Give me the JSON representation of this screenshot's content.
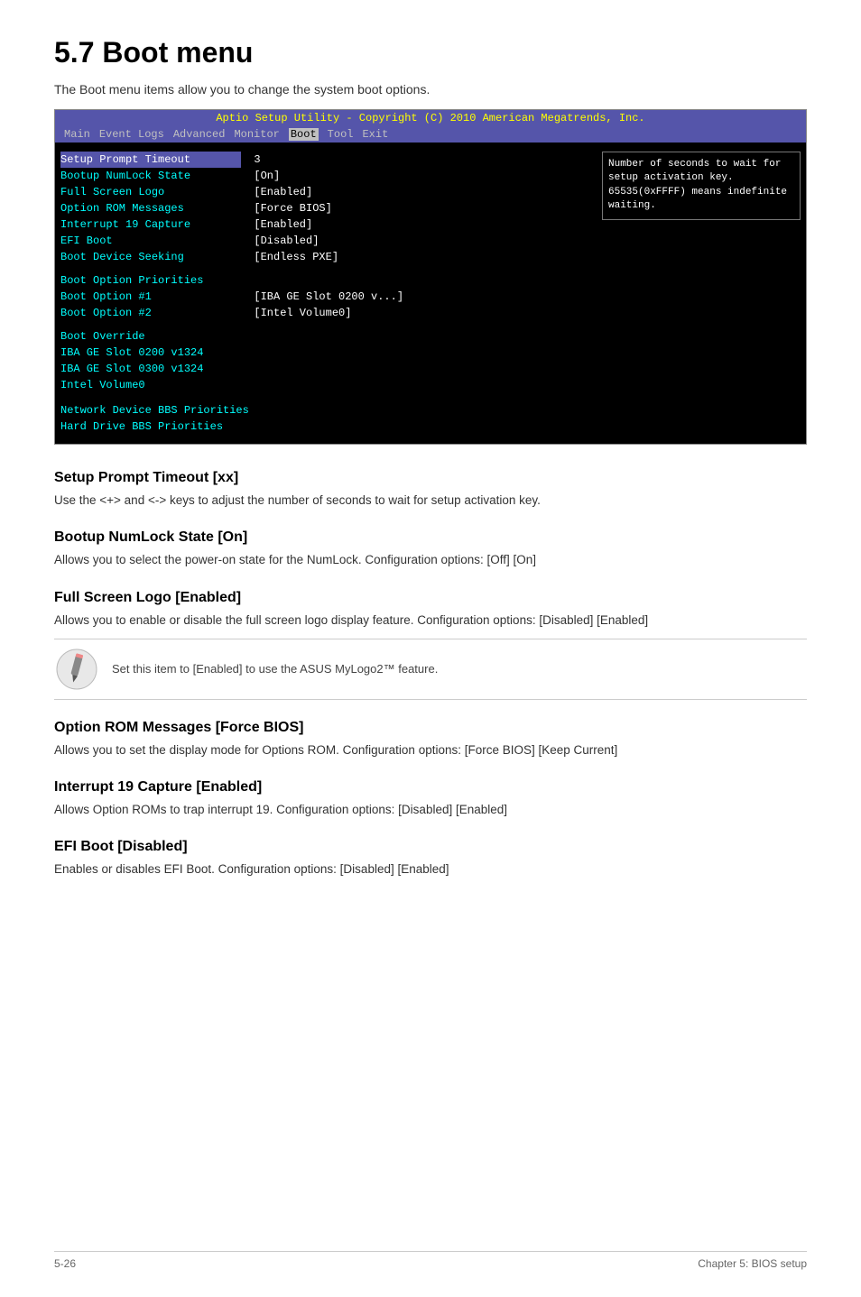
{
  "page": {
    "title": "5.7   Boot menu",
    "intro": "The Boot menu items allow you to change the system boot options."
  },
  "bios": {
    "header": "Aptio Setup Utility - Copyright (C) 2010 American Megatrends, Inc.",
    "nav_items": [
      "Main",
      "Event Logs",
      "Advanced",
      "Monitor",
      "Boot",
      "Tool",
      "Exit"
    ],
    "active_nav": "Boot",
    "rows": [
      {
        "label": "Setup Prompt Timeout",
        "value": "3",
        "highlight": true
      },
      {
        "label": "Bootup NumLock State",
        "value": "[On]"
      },
      {
        "label": "Full Screen Logo",
        "value": "[Enabled]"
      },
      {
        "label": "Option ROM Messages",
        "value": "[Force BIOS]"
      },
      {
        "label": "Interrupt 19 Capture",
        "value": "[Enabled]"
      },
      {
        "label": "EFI Boot",
        "value": "[Disabled]"
      },
      {
        "label": "Boot Device Seeking",
        "value": "[Endless PXE]"
      }
    ],
    "boot_priorities_title": "Boot Option Priorities",
    "boot_options": [
      {
        "label": "Boot Option #1",
        "value": "[IBA GE Slot 0200 v...]"
      },
      {
        "label": "Boot Option #2",
        "value": "[Intel Volume0]"
      }
    ],
    "boot_override_title": "Boot Override",
    "override_items": [
      "IBA GE Slot 0200 v1324",
      "IBA GE Slot 0300 v1324",
      "Intel Volume0"
    ],
    "network_items": [
      "Network Device BBS Priorities",
      "Hard Drive BBS Priorities"
    ],
    "help_text": "Number of seconds to wait for setup activation key. 65535(0xFFFF) means indefinite waiting."
  },
  "sections": [
    {
      "id": "setup-prompt-timeout",
      "heading": "Setup Prompt Timeout [xx]",
      "body": "Use the <+> and <-> keys to adjust the number of seconds to wait for setup activation key."
    },
    {
      "id": "bootup-numlock",
      "heading": "Bootup NumLock State [On]",
      "body": "Allows you to select the power-on state for the NumLock.\nConfiguration options: [Off] [On]"
    },
    {
      "id": "full-screen-logo",
      "heading": "Full Screen Logo [Enabled]",
      "body": "Allows you to enable or disable the full screen logo display feature.\nConfiguration options: [Disabled] [Enabled]"
    },
    {
      "id": "option-rom-messages",
      "heading": "Option ROM Messages [Force BIOS]",
      "body": "Allows you to set the display mode for Options ROM.\nConfiguration options: [Force BIOS] [Keep Current]"
    },
    {
      "id": "interrupt-19-capture",
      "heading": "Interrupt 19 Capture [Enabled]",
      "body": "Allows Option ROMs to trap interrupt 19.\nConfiguration options: [Disabled] [Enabled]"
    },
    {
      "id": "efi-boot",
      "heading": "EFI Boot [Disabled]",
      "body": "Enables or disables EFI Boot.\nConfiguration options: [Disabled] [Enabled]"
    }
  ],
  "note": {
    "text": "Set this item to [Enabled] to use the ASUS MyLogo2™ feature."
  },
  "footer": {
    "left": "5-26",
    "right": "Chapter 5: BIOS setup"
  }
}
